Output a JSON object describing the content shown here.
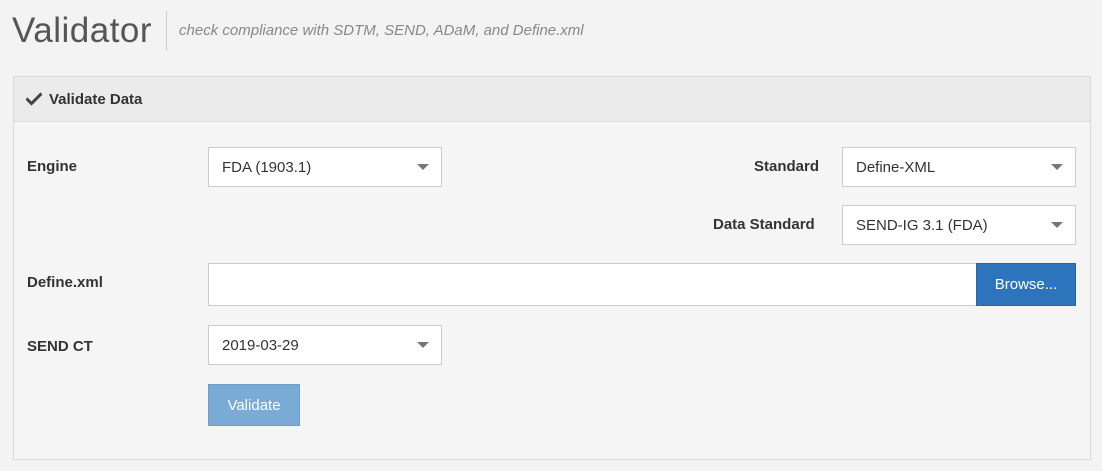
{
  "header": {
    "title": "Validator",
    "subtitle": "check compliance with SDTM, SEND, ADaM, and Define.xml"
  },
  "panel": {
    "heading": "Validate Data",
    "heading_icon": "check-icon"
  },
  "form": {
    "engine": {
      "label": "Engine",
      "value": "FDA (1903.1)"
    },
    "standard": {
      "label": "Standard",
      "value": "Define-XML"
    },
    "data_standard": {
      "label": "Data Standard",
      "value": "SEND-IG 3.1 (FDA)"
    },
    "define_xml": {
      "label": "Define.xml",
      "value": "",
      "browse_label": "Browse..."
    },
    "send_ct": {
      "label": "SEND CT",
      "value": "2019-03-29"
    },
    "validate_label": "Validate"
  },
  "colors": {
    "primary": "#2c75bd",
    "primary_disabled": "#7aaad6"
  }
}
